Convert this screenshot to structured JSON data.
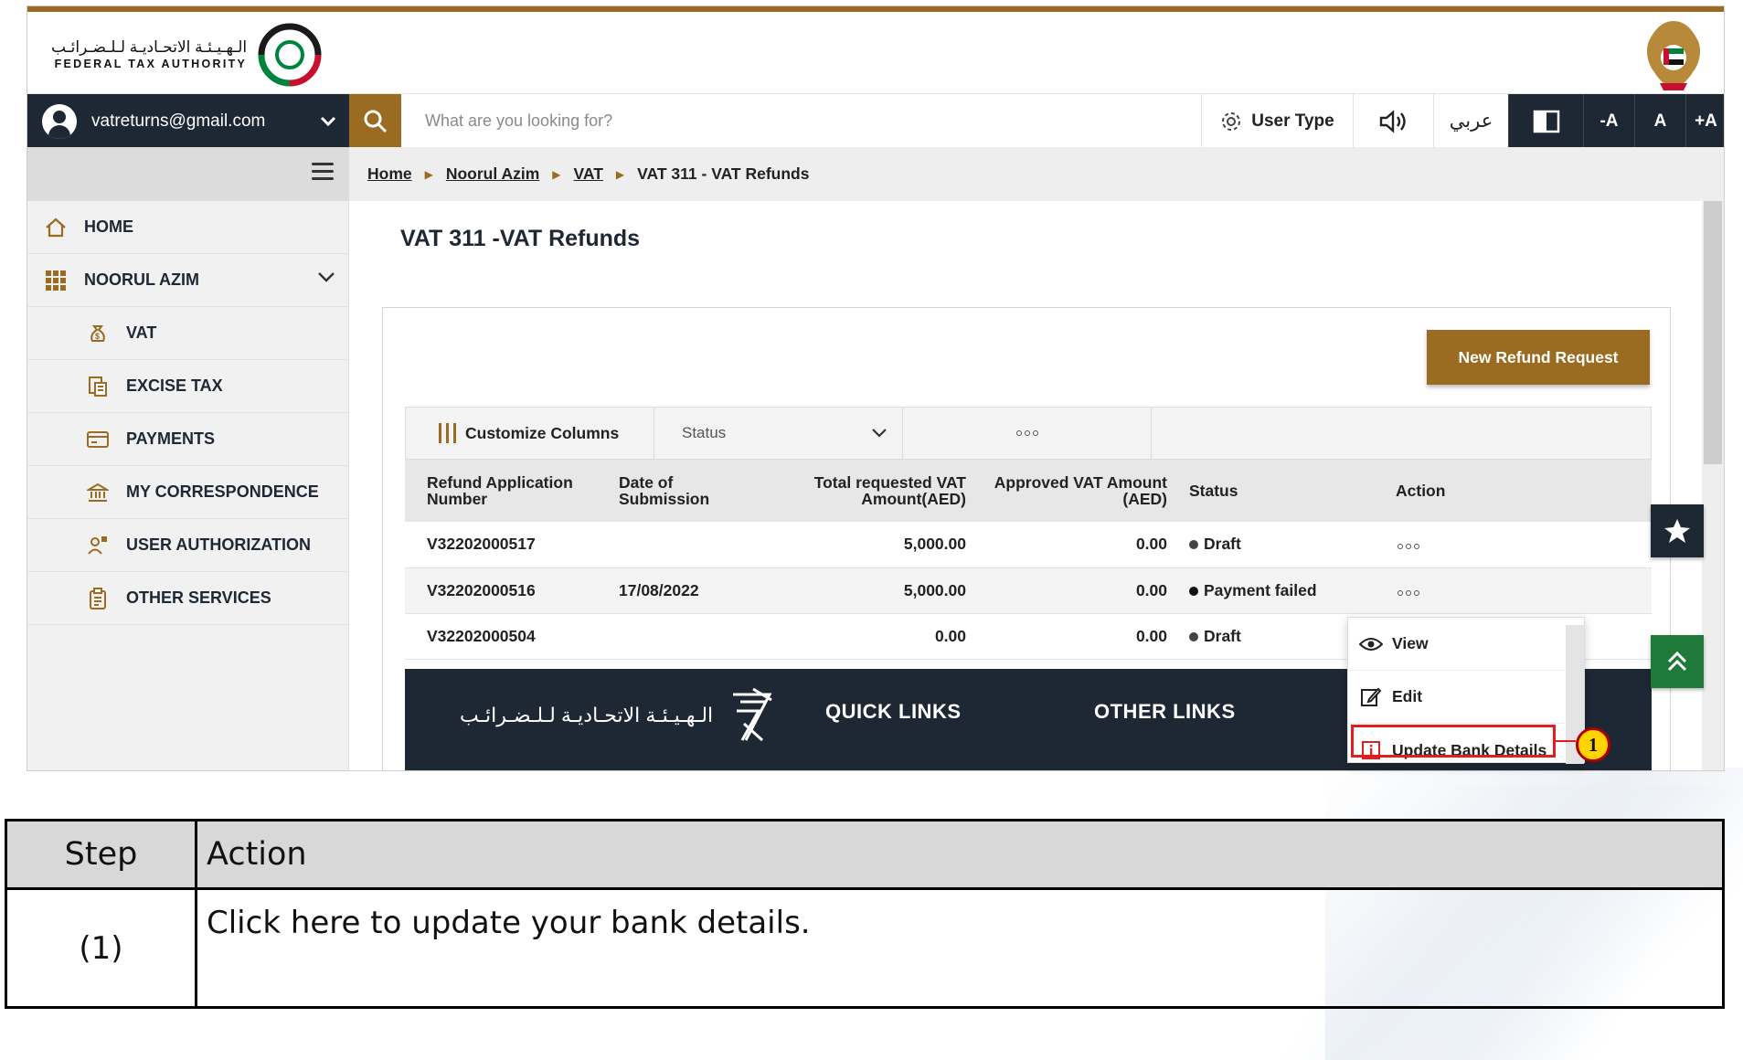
{
  "header": {
    "logo_ar": "الـهـيـئـة الاتحـاديـة لـلـضـرائـب",
    "logo_en": "FEDERAL TAX AUTHORITY"
  },
  "navbar": {
    "user_email": "vatreturns@gmail.com",
    "search_placeholder": "What are you looking for?",
    "user_type_label": "User Type",
    "arabic_label": "عربي",
    "font_decrease": "-A",
    "font_normal": "A",
    "font_increase": "+A"
  },
  "sidebar": {
    "items": [
      {
        "label": "HOME",
        "icon": "home-icon"
      },
      {
        "label": "NOORUL AZIM",
        "icon": "grid-icon"
      },
      {
        "label": "VAT",
        "icon": "money-bag-icon"
      },
      {
        "label": "EXCISE TAX",
        "icon": "document-tax-icon"
      },
      {
        "label": "PAYMENTS",
        "icon": "card-icon"
      },
      {
        "label": "MY CORRESPONDENCE",
        "icon": "bank-icon"
      },
      {
        "label": "USER AUTHORIZATION",
        "icon": "user-key-icon"
      },
      {
        "label": "OTHER SERVICES",
        "icon": "clipboard-icon"
      }
    ]
  },
  "breadcrumb": {
    "items": [
      "Home",
      "Noorul Azim",
      "VAT"
    ],
    "current": "VAT 311 - VAT Refunds"
  },
  "page": {
    "title": "VAT 311 -VAT Refunds",
    "new_button": "New Refund Request"
  },
  "toolbar": {
    "customize_label": "Customize Columns",
    "status_placeholder": "Status"
  },
  "table": {
    "headers": [
      "Refund Application Number",
      "Date of Submission",
      "Total requested VAT Amount(AED)",
      "Approved VAT Amount (AED)",
      "Status",
      "Action"
    ],
    "rows": [
      {
        "number": "V32202000517",
        "date": "",
        "total": "5,000.00",
        "approved": "0.00",
        "status": "Draft"
      },
      {
        "number": "V32202000516",
        "date": "17/08/2022",
        "total": "5,000.00",
        "approved": "0.00",
        "status": "Payment failed"
      },
      {
        "number": "V32202000504",
        "date": "",
        "total": "0.00",
        "approved": "0.00",
        "status": "Draft"
      }
    ]
  },
  "footer": {
    "logo_ar": "الـهـيـئـة الاتحـاديـة لـلـضـرائـب",
    "quick_links": "QUICK LINKS",
    "other_links": "OTHER LINKS"
  },
  "popup": {
    "items": [
      "View",
      "Edit",
      "Update Bank Details"
    ]
  },
  "callout_number": "1",
  "steps": {
    "header_step": "Step",
    "header_action": "Action",
    "rows": [
      {
        "step": "(1)",
        "action": "Click here to update your bank details."
      }
    ]
  },
  "colors": {
    "brand_gold": "#9c6b22",
    "brand_navy": "#1e2734",
    "highlight_red": "#e02020",
    "callout_yellow": "#ffd400"
  }
}
